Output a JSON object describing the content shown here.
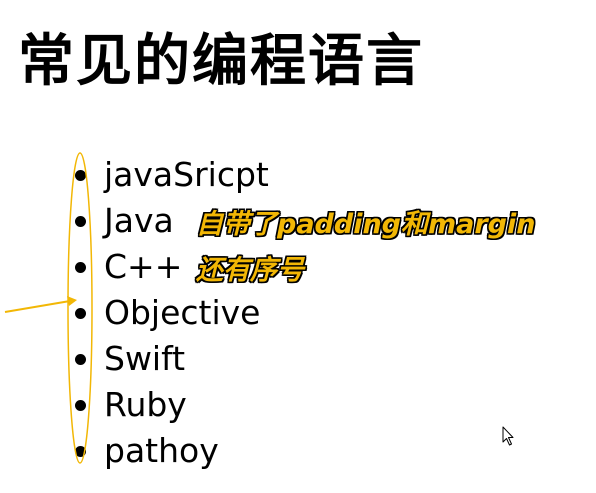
{
  "page": {
    "title": "常见的编程语言"
  },
  "list": {
    "items": [
      "javaSricpt",
      "Java",
      "C++",
      "Objective",
      "Swift",
      "Ruby",
      "pathoy"
    ]
  },
  "annotations": {
    "padding_note": "自带了padding和margin",
    "number_note": "还有序号",
    "color": "#f2b705",
    "outline_color": "#000000"
  },
  "icons": {
    "cursor": "mouse-pointer-icon"
  }
}
